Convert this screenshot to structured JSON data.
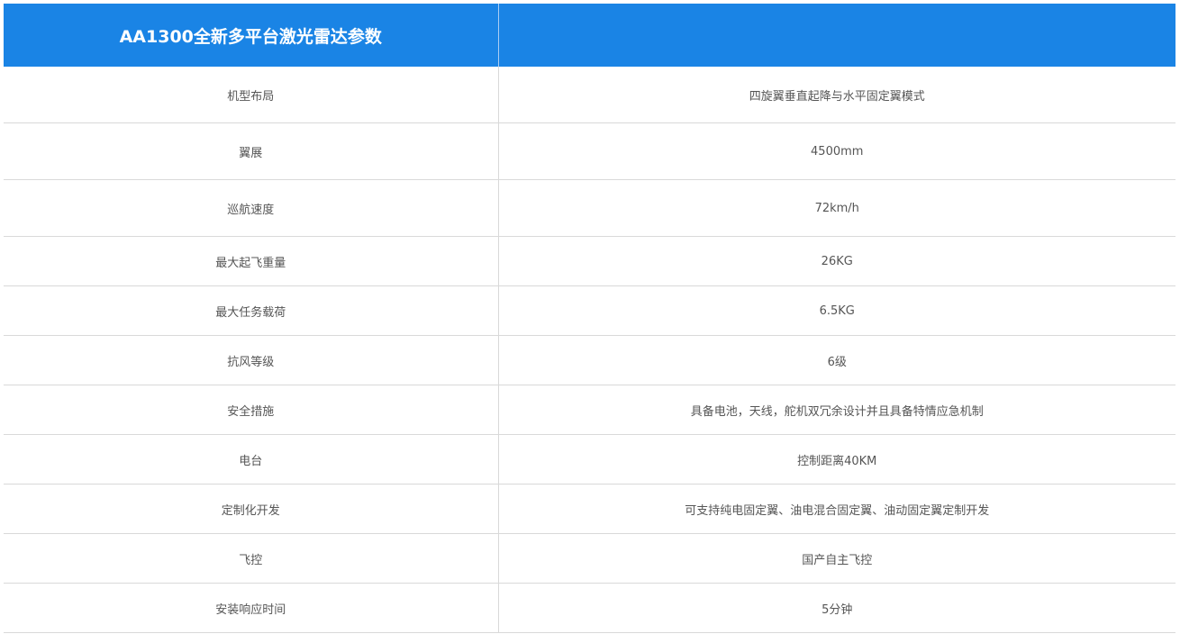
{
  "table": {
    "title": "AA1300全新多平台激光雷达参数",
    "header_right": "",
    "rows": [
      {
        "label": "机型布局",
        "value": "四旋翼垂直起降与水平固定翼模式"
      },
      {
        "label": "翼展",
        "value": "4500mm"
      },
      {
        "label": "巡航速度",
        "value": "72km/h"
      },
      {
        "label": "最大起飞重量",
        "value": "26KG"
      },
      {
        "label": "最大任务载荷",
        "value": "6.5KG"
      },
      {
        "label": "抗风等级",
        "value": "6级"
      },
      {
        "label": "安全措施",
        "value": "具备电池，天线，舵机双冗余设计并且具备特情应急机制"
      },
      {
        "label": "电台",
        "value": "控制距离40KM"
      },
      {
        "label": "定制化开发",
        "value": "可支持纯电固定翼、油电混合固定翼、油动固定翼定制开发"
      },
      {
        "label": "飞控",
        "value": "国产自主飞控"
      },
      {
        "label": "安装响应时间",
        "value": "5分钟"
      }
    ]
  },
  "colors": {
    "header_bg": "#1a84e5",
    "header_text": "#ffffff",
    "cell_text": "#555555",
    "border": "#d9d9d9"
  }
}
